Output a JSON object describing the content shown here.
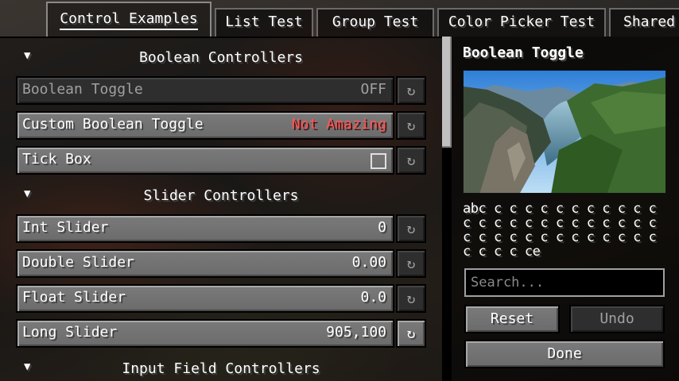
{
  "tabs": [
    {
      "label": "Control Examples",
      "active": true
    },
    {
      "label": "List Test"
    },
    {
      "label": "Group Test"
    },
    {
      "label": "Color Picker Test"
    },
    {
      "label": "Shared"
    }
  ],
  "sections": {
    "boolean": "Boolean Controllers",
    "slider": "Slider Controllers",
    "input": "Input Field Controllers"
  },
  "controls": {
    "boolean_toggle": {
      "label": "Boolean Toggle",
      "value": "OFF"
    },
    "custom_boolean_toggle": {
      "label": "Custom Boolean Toggle",
      "value": "Not Amazing"
    },
    "tick_box": {
      "label": "Tick Box",
      "checked": false
    },
    "int_slider": {
      "label": "Int Slider",
      "value": "0"
    },
    "double_slider": {
      "label": "Double Slider",
      "value": "0.00"
    },
    "float_slider": {
      "label": "Float Slider",
      "value": "0.0"
    },
    "long_slider": {
      "label": "Long Slider",
      "value": "905,100"
    }
  },
  "icons": {
    "reset": "reset-arrow-icon",
    "collapse": "collapse-arrow-icon"
  },
  "side_panel": {
    "title": "Boolean Toggle",
    "description": "abc c c c c c c c c c c c c c c c c c c c c c c c c c c c c c c c c c c c c c c c c c ce",
    "search_placeholder": "Search...",
    "reset_label": "Reset",
    "undo_label": "Undo",
    "done_label": "Done"
  },
  "colors": {
    "red_value": "#ff5555",
    "panel_bg": "#000000"
  }
}
